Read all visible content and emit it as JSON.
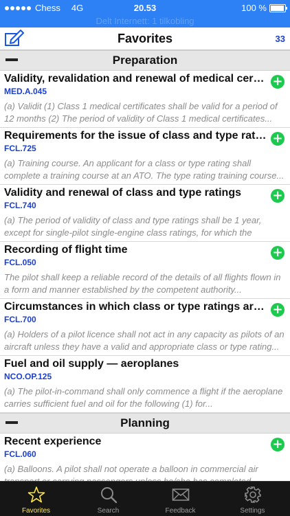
{
  "status_bar": {
    "carrier": "Chess",
    "network": "4G",
    "time": "20.53",
    "battery": "100 %",
    "hotspot_text": "Delt Internett: 1 tilkobling"
  },
  "nav": {
    "title": "Favorites",
    "count": "33",
    "edit_icon": "compose-icon"
  },
  "sections": [
    {
      "title": "Preparation",
      "items": [
        {
          "title": "Validity, revalidation and renewal of medical certificates",
          "code": "MED.A.045",
          "description": "(a) Validit  (1) Class 1 medical certificates shall be valid for a period of 12 months  (2) The period of validity of Class 1 medical certificates..."
        },
        {
          "title": "Requirements for the issue of class and type ratings",
          "code": "FCL.725",
          "description": "(a) Training course. An applicant for a class or type rating shall complete a training course at an ATO. The type rating training course..."
        },
        {
          "title": "Validity and renewal of class and type ratings",
          "code": "FCL.740",
          "description": "(a) The period of validity of class and type ratings shall be 1 year, except for single-pilot single-engine class ratings, for which the period..."
        },
        {
          "title": "Recording of flight time",
          "code": "FCL.050",
          "description": "The pilot shall keep a reliable record of the details of all flights flown in a form and manner established by the competent authority..."
        },
        {
          "title": "Circumstances in which class or type ratings are required",
          "code": "FCL.700",
          "description": "(a) Holders of a pilot licence shall not act in any capacity as pilots of an aircraft unless they have a valid and appropriate class or type rating..."
        },
        {
          "title": "Fuel and oil supply — aeroplanes",
          "code": "NCO.OP.125",
          "description": "(a)  The pilot-in-command shall only commence a flight if the aeroplane carries sufficient fuel and oil for the following  (1)  for..."
        }
      ]
    },
    {
      "title": "Planning",
      "items": [
        {
          "title": "Recent experience",
          "code": "FCL.060",
          "description": "(a) Balloons. A pilot shall not operate a balloon in commercial air transport or carrying passengers unless he/she has completed..."
        }
      ]
    }
  ],
  "tabs": [
    {
      "label": "Favorites",
      "icon": "star-icon",
      "active": true
    },
    {
      "label": "Search",
      "icon": "search-icon",
      "active": false
    },
    {
      "label": "Feedback",
      "icon": "mail-icon",
      "active": false
    },
    {
      "label": "Settings",
      "icon": "gear-icon",
      "active": false
    }
  ],
  "colors": {
    "status_bar": "#2e80f5",
    "code_text": "#1b3fd0",
    "add_button": "#1ec94f",
    "tab_active": "#ffe84a",
    "tab_bar": "#161616"
  }
}
